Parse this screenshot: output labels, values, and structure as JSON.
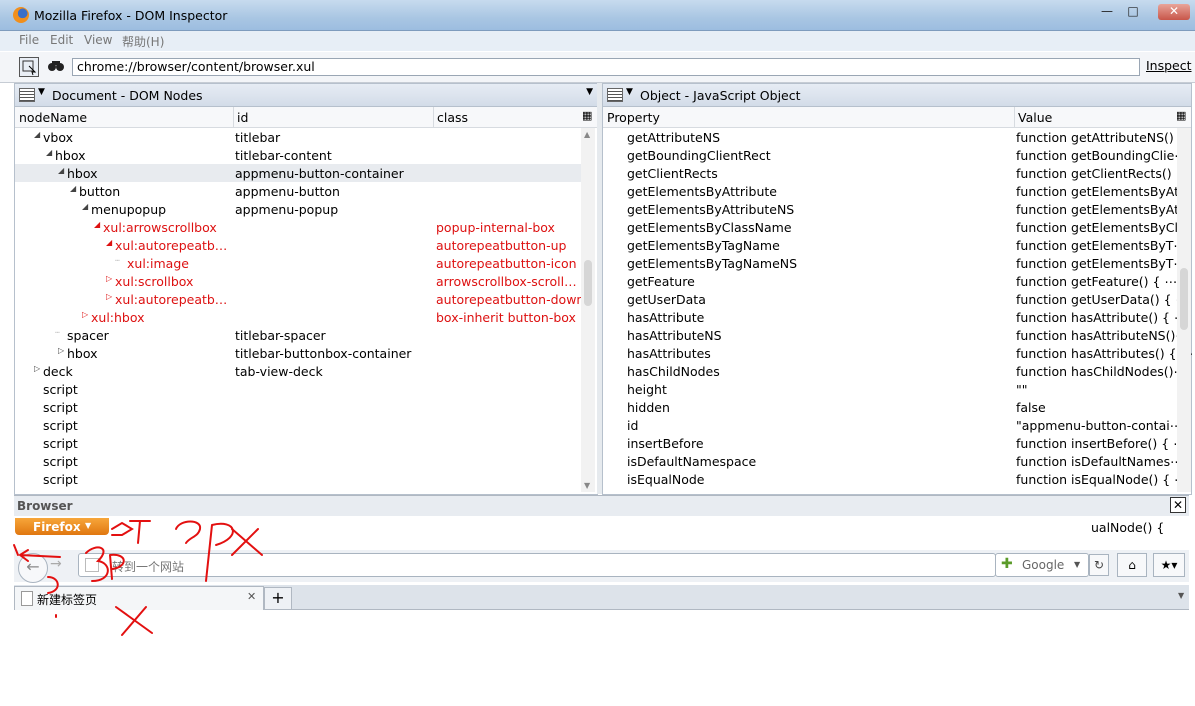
{
  "window": {
    "title": "Mozilla Firefox - DOM Inspector"
  },
  "menus": [
    "File",
    "Edit",
    "View",
    "帮助(H)"
  ],
  "toolbar": {
    "url": "chrome://browser/content/browser.xul",
    "inspect_label": "Inspect"
  },
  "left_panel": {
    "title": "Document - DOM Nodes",
    "columns": [
      "nodeName",
      "id",
      "class"
    ],
    "rows": [
      {
        "name": "vbox",
        "id": "titlebar",
        "class": "",
        "indent": 0,
        "twisty": "open",
        "red": false
      },
      {
        "name": "hbox",
        "id": "titlebar-content",
        "class": "",
        "indent": 1,
        "twisty": "open",
        "red": false
      },
      {
        "name": "hbox",
        "id": "appmenu-button-container",
        "class": "",
        "indent": 2,
        "twisty": "open",
        "red": false
      },
      {
        "name": "button",
        "id": "appmenu-button",
        "class": "",
        "indent": 3,
        "twisty": "open",
        "red": false
      },
      {
        "name": "menupopup",
        "id": "appmenu-popup",
        "class": "",
        "indent": 4,
        "twisty": "open",
        "red": false
      },
      {
        "name": "xul:arrowscrollbox",
        "id": "",
        "class": "popup-internal-box",
        "indent": 5,
        "twisty": "open",
        "red": true
      },
      {
        "name": "xul:autorepeatb…",
        "id": "",
        "class": "autorepeatbutton-up",
        "indent": 6,
        "twisty": "open",
        "red": true
      },
      {
        "name": "xul:image",
        "id": "",
        "class": "autorepeatbutton-icon",
        "indent": 7,
        "twisty": "none",
        "red": true
      },
      {
        "name": "xul:scrollbox",
        "id": "",
        "class": "arrowscrollbox-scroll…",
        "indent": 6,
        "twisty": "closed",
        "red": true
      },
      {
        "name": "xul:autorepeatb…",
        "id": "",
        "class": "autorepeatbutton-down",
        "indent": 6,
        "twisty": "closed",
        "red": true
      },
      {
        "name": "xul:hbox",
        "id": "",
        "class": "box-inherit button-box",
        "indent": 4,
        "twisty": "closed",
        "red": true
      },
      {
        "name": "spacer",
        "id": "titlebar-spacer",
        "class": "",
        "indent": 2,
        "twisty": "none",
        "red": false
      },
      {
        "name": "hbox",
        "id": "titlebar-buttonbox-container",
        "class": "",
        "indent": 2,
        "twisty": "closed",
        "red": false
      },
      {
        "name": "deck",
        "id": "tab-view-deck",
        "class": "",
        "indent": 0,
        "twisty": "closed",
        "red": false
      },
      {
        "name": "script",
        "id": "",
        "class": "",
        "indent": 0,
        "twisty": "none",
        "red": false
      },
      {
        "name": "script",
        "id": "",
        "class": "",
        "indent": 0,
        "twisty": "none",
        "red": false
      },
      {
        "name": "script",
        "id": "",
        "class": "",
        "indent": 0,
        "twisty": "none",
        "red": false
      },
      {
        "name": "script",
        "id": "",
        "class": "",
        "indent": 0,
        "twisty": "none",
        "red": false
      },
      {
        "name": "script",
        "id": "",
        "class": "",
        "indent": 0,
        "twisty": "none",
        "red": false
      },
      {
        "name": "script",
        "id": "",
        "class": "",
        "indent": 0,
        "twisty": "none",
        "red": false
      }
    ],
    "selected_index": 2
  },
  "right_panel": {
    "title": "Object - JavaScript Object",
    "columns": [
      "Property",
      "Value"
    ],
    "rows": [
      {
        "p": "getAttributeNS",
        "v": "function getAttributeNS() ⋯"
      },
      {
        "p": "getBoundingClientRect",
        "v": "function getBoundingClie⋯"
      },
      {
        "p": "getClientRects",
        "v": "function getClientRects() ⋯"
      },
      {
        "p": "getElementsByAttribute",
        "v": "function getElementsByAt⋯"
      },
      {
        "p": "getElementsByAttributeNS",
        "v": "function getElementsByAt⋯"
      },
      {
        "p": "getElementsByClassName",
        "v": "function getElementsByCl⋯"
      },
      {
        "p": "getElementsByTagName",
        "v": "function getElementsByT⋯"
      },
      {
        "p": "getElementsByTagNameNS",
        "v": "function getElementsByT⋯"
      },
      {
        "p": "getFeature",
        "v": "function getFeature() { ⋯"
      },
      {
        "p": "getUserData",
        "v": "function getUserData() { ⋯"
      },
      {
        "p": "hasAttribute",
        "v": "function hasAttribute() { ⋯"
      },
      {
        "p": "hasAttributeNS",
        "v": "function hasAttributeNS()⋯"
      },
      {
        "p": "hasAttributes",
        "v": "function hasAttributes() { ⋯"
      },
      {
        "p": "hasChildNodes",
        "v": "function hasChildNodes()⋯"
      },
      {
        "p": "height",
        "v": "\"\""
      },
      {
        "p": "hidden",
        "v": "false"
      },
      {
        "p": "id",
        "v": "\"appmenu-button-contai⋯"
      },
      {
        "p": "insertBefore",
        "v": "function insertBefore() { ⋯"
      },
      {
        "p": "isDefaultNamespace",
        "v": "function isDefaultNames⋯"
      },
      {
        "p": "isEqualNode",
        "v": "function isEqualNode() { ⋯"
      }
    ]
  },
  "browser": {
    "label": "Browser",
    "firefox_button": "Firefox",
    "address_placeholder": "转到一个网站",
    "search_engine": "Google",
    "tab_title": "新建标签页",
    "partial_text": "ualNode() {"
  }
}
